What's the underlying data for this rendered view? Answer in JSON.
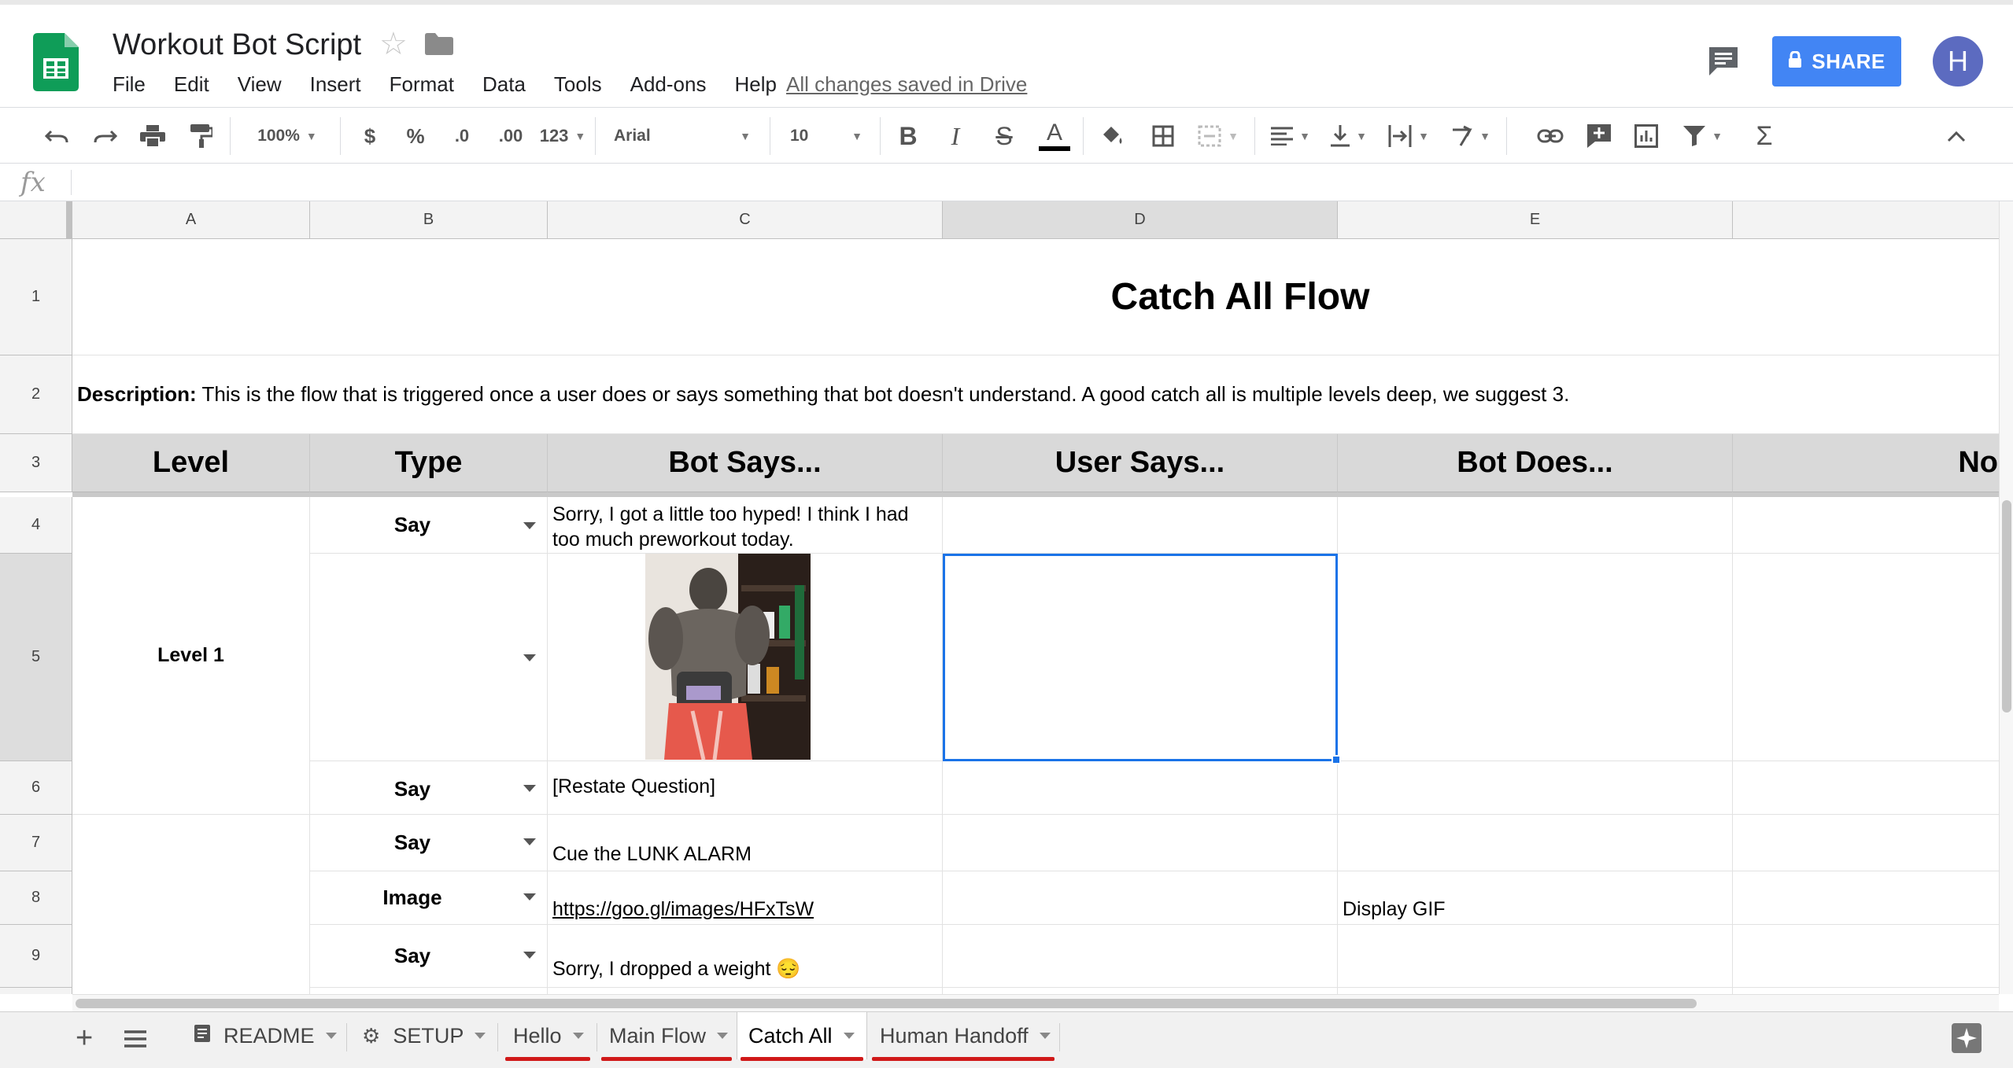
{
  "app": {
    "doc_title": "Workout Bot Script",
    "save_status": "All changes saved in Drive",
    "share_label": "SHARE",
    "avatar_initial": "H",
    "menu": [
      "File",
      "Edit",
      "View",
      "Insert",
      "Format",
      "Data",
      "Tools",
      "Add-ons",
      "Help"
    ]
  },
  "toolbar": {
    "zoom": "100%",
    "currency": "$",
    "percent": "%",
    "decrease_decimals": ".0",
    "increase_decimals": ".00",
    "more_formats": "123",
    "font": "Arial",
    "font_size": "10"
  },
  "formula_bar": {
    "fx_label": "fx",
    "value": ""
  },
  "grid": {
    "columns": [
      "A",
      "B",
      "C",
      "D",
      "E"
    ],
    "rows": [
      "1",
      "2",
      "3",
      "4",
      "5",
      "6",
      "7",
      "8",
      "9"
    ],
    "title": "Catch All Flow",
    "description_label": "Description:",
    "description_text": " This is the flow that is triggered once a user does or says something that bot doesn't understand. A good catch all is multiple levels deep, we suggest 3.",
    "headers": [
      "Level",
      "Type",
      "Bot Says...",
      "User Says...",
      "Bot Does...",
      "No"
    ],
    "level_1": "Level 1",
    "row4": {
      "type": "Say",
      "bot_says": "Sorry, I got a little too hyped! I think I had too much preworkout today."
    },
    "row5": {
      "type": ""
    },
    "row6": {
      "type": "Say",
      "bot_says": "[Restate Question]"
    },
    "row7": {
      "type": "Say",
      "bot_says": "Cue the LUNK ALARM"
    },
    "row8": {
      "type": "Image",
      "bot_says": "https://goo.gl/images/HFxTsW",
      "bot_does": "Display GIF"
    },
    "row9": {
      "type": "Say",
      "bot_says": "Sorry, I dropped a weight 😔"
    }
  },
  "sheets": [
    "README",
    "SETUP",
    "Hello",
    "Main Flow",
    "Catch All",
    "Human Handoff"
  ],
  "active_sheet": "Catch All",
  "colors": {
    "accent": "#1a73e8",
    "share": "#4285f4",
    "avatar": "#5c6bc0",
    "header_fill": "#d9d9d9",
    "tab_underline": "#d01919",
    "sheets_green": "#0f9d58"
  }
}
